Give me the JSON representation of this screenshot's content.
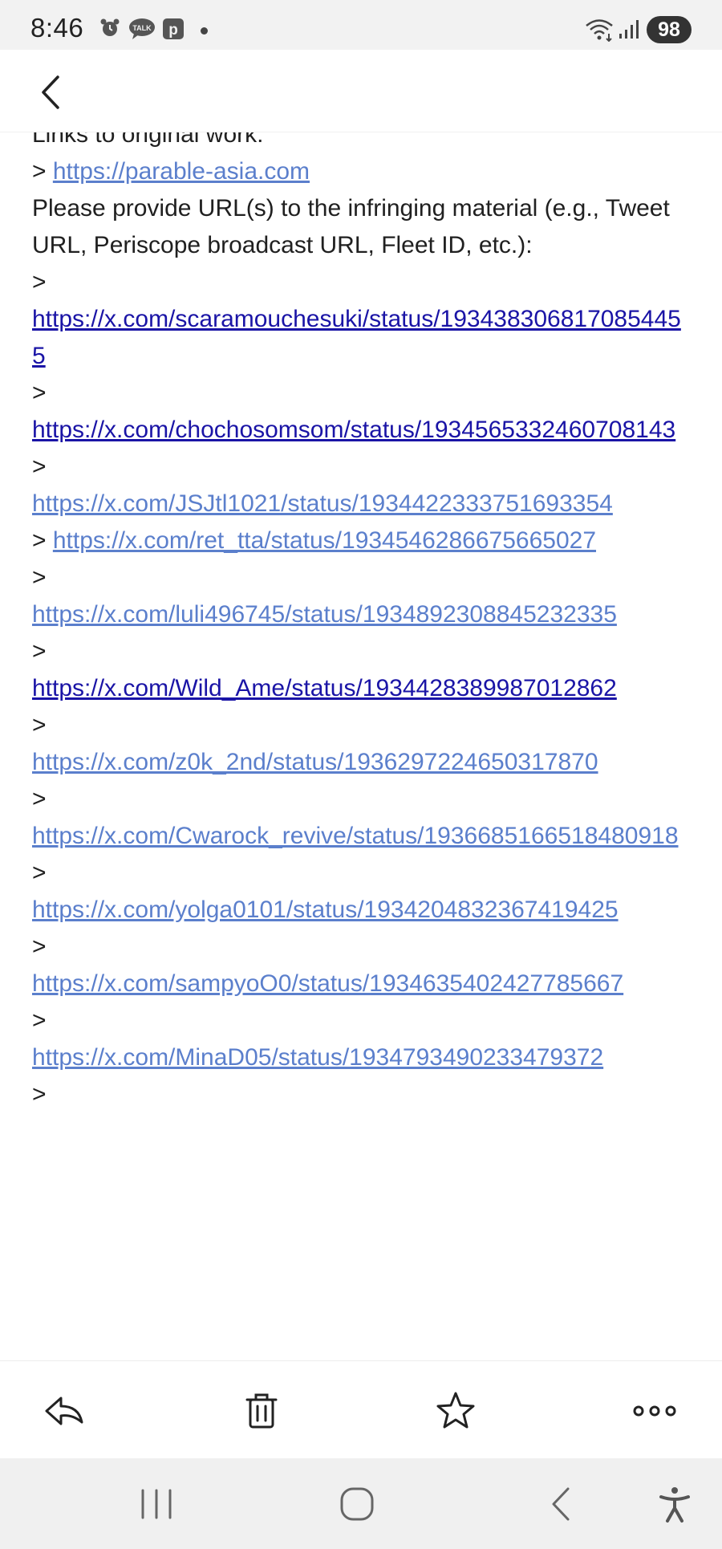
{
  "status_bar": {
    "time": "8:46",
    "talk_label": "TALK",
    "p_label": "p",
    "battery": "98"
  },
  "icons": {
    "back": "chevron-left-icon",
    "reply": "reply-icon",
    "delete": "trash-icon",
    "star": "star-icon",
    "more": "more-horizontal-icon"
  },
  "email": {
    "links_heading": "Links to original work:",
    "original_prefix": "> ",
    "original_link": "https://parable-asia.com",
    "request_text": "Please provide URL(s) to the infringing material (e.g., Tweet URL, Periscope broadcast URL, Fleet ID, etc.):",
    "quote_marker": ">",
    "infringing_links": [
      {
        "url": "https://x.com/scaramouchesuki/status/1934383068170854455",
        "inline": false,
        "visited": true
      },
      {
        "url": "https://x.com/chochosomsom/status/1934565332460708143",
        "inline": false,
        "visited": true
      },
      {
        "url": "https://x.com/JSJtl1021/status/1934422333751693354",
        "inline": false,
        "visited": false
      },
      {
        "url": "https://x.com/ret_tta/status/1934546286675665027",
        "inline": true,
        "visited": false
      },
      {
        "url": "https://x.com/luli496745/status/1934892308845232335",
        "inline": false,
        "visited": false
      },
      {
        "url": "https://x.com/Wild_Ame/status/1934428389987012862",
        "inline": false,
        "visited": true
      },
      {
        "url": "https://x.com/z0k_2nd/status/1936297224650317870",
        "inline": false,
        "visited": false
      },
      {
        "url": "https://x.com/Cwarock_revive/status/1936685166518480918",
        "inline": false,
        "visited": false
      },
      {
        "url": "https://x.com/yolga0101/status/1934204832367419425",
        "inline": false,
        "visited": false
      },
      {
        "url": "https://x.com/sampyoO0/status/1934635402427785667",
        "inline": false,
        "visited": false
      },
      {
        "url": "https://x.com/MinaD05/status/1934793490233479372",
        "inline": false,
        "visited": false
      }
    ],
    "trailing_marker": ">"
  },
  "colors": {
    "link": "#5b7fcc",
    "visited_link": "#1a14a6",
    "text": "#202020"
  }
}
